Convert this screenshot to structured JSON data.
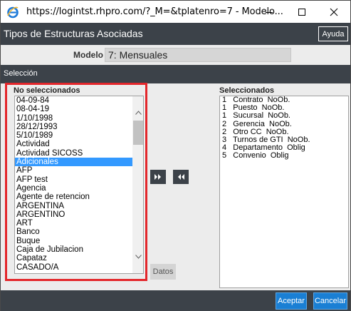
{
  "window": {
    "title": "https://logintst.rhpro.com/?_M=&tplatenro=7 - Modelo...",
    "icon": "internet-explorer-icon"
  },
  "header": {
    "title": "Tipos de Estructuras Asociadas",
    "help_label": "Ayuda"
  },
  "model": {
    "label": "Modelo",
    "value": "7: Mensuales"
  },
  "selection": {
    "title": "Selección",
    "unselected_title": "No seleccionados",
    "selected_title": "Seleccionados",
    "unselected_items": [
      "04-09-84",
      "08-04-19",
      "1/10/1998",
      "28/12/1993",
      "5/10/1989",
      "Actividad",
      "Actividad SICOSS",
      "Adicionales",
      "AFP",
      "AFP test",
      "Agencia",
      "Agente de retencion",
      "ARGENTINA",
      "ARGENTINO",
      "ART",
      "Banco",
      "Buque",
      "Caja de Jubilacion",
      "Capataz",
      "CASADO/A"
    ],
    "selected_unselected_item": "Adicionales",
    "selected_items": [
      "1   Contrato  NoOb.",
      "1   Puesto  NoOb.",
      "1   Sucursal  NoOb.",
      "2   Gerencia  NoOb.",
      "2   Otro CC  NoOb.",
      "3   Turnos de GTI  NoOb.",
      "4   Departamento  Oblig",
      "5   Convenio  Oblig"
    ],
    "datos_tab": "Datos"
  },
  "footer": {
    "ok_label": "Aceptar",
    "cancel_label": "Cancelar"
  },
  "colors": {
    "dark_bar": "#3c4249",
    "accent_button": "#1a7fd4",
    "list_selection": "#3399ff",
    "highlight_box": "#e3262b"
  }
}
